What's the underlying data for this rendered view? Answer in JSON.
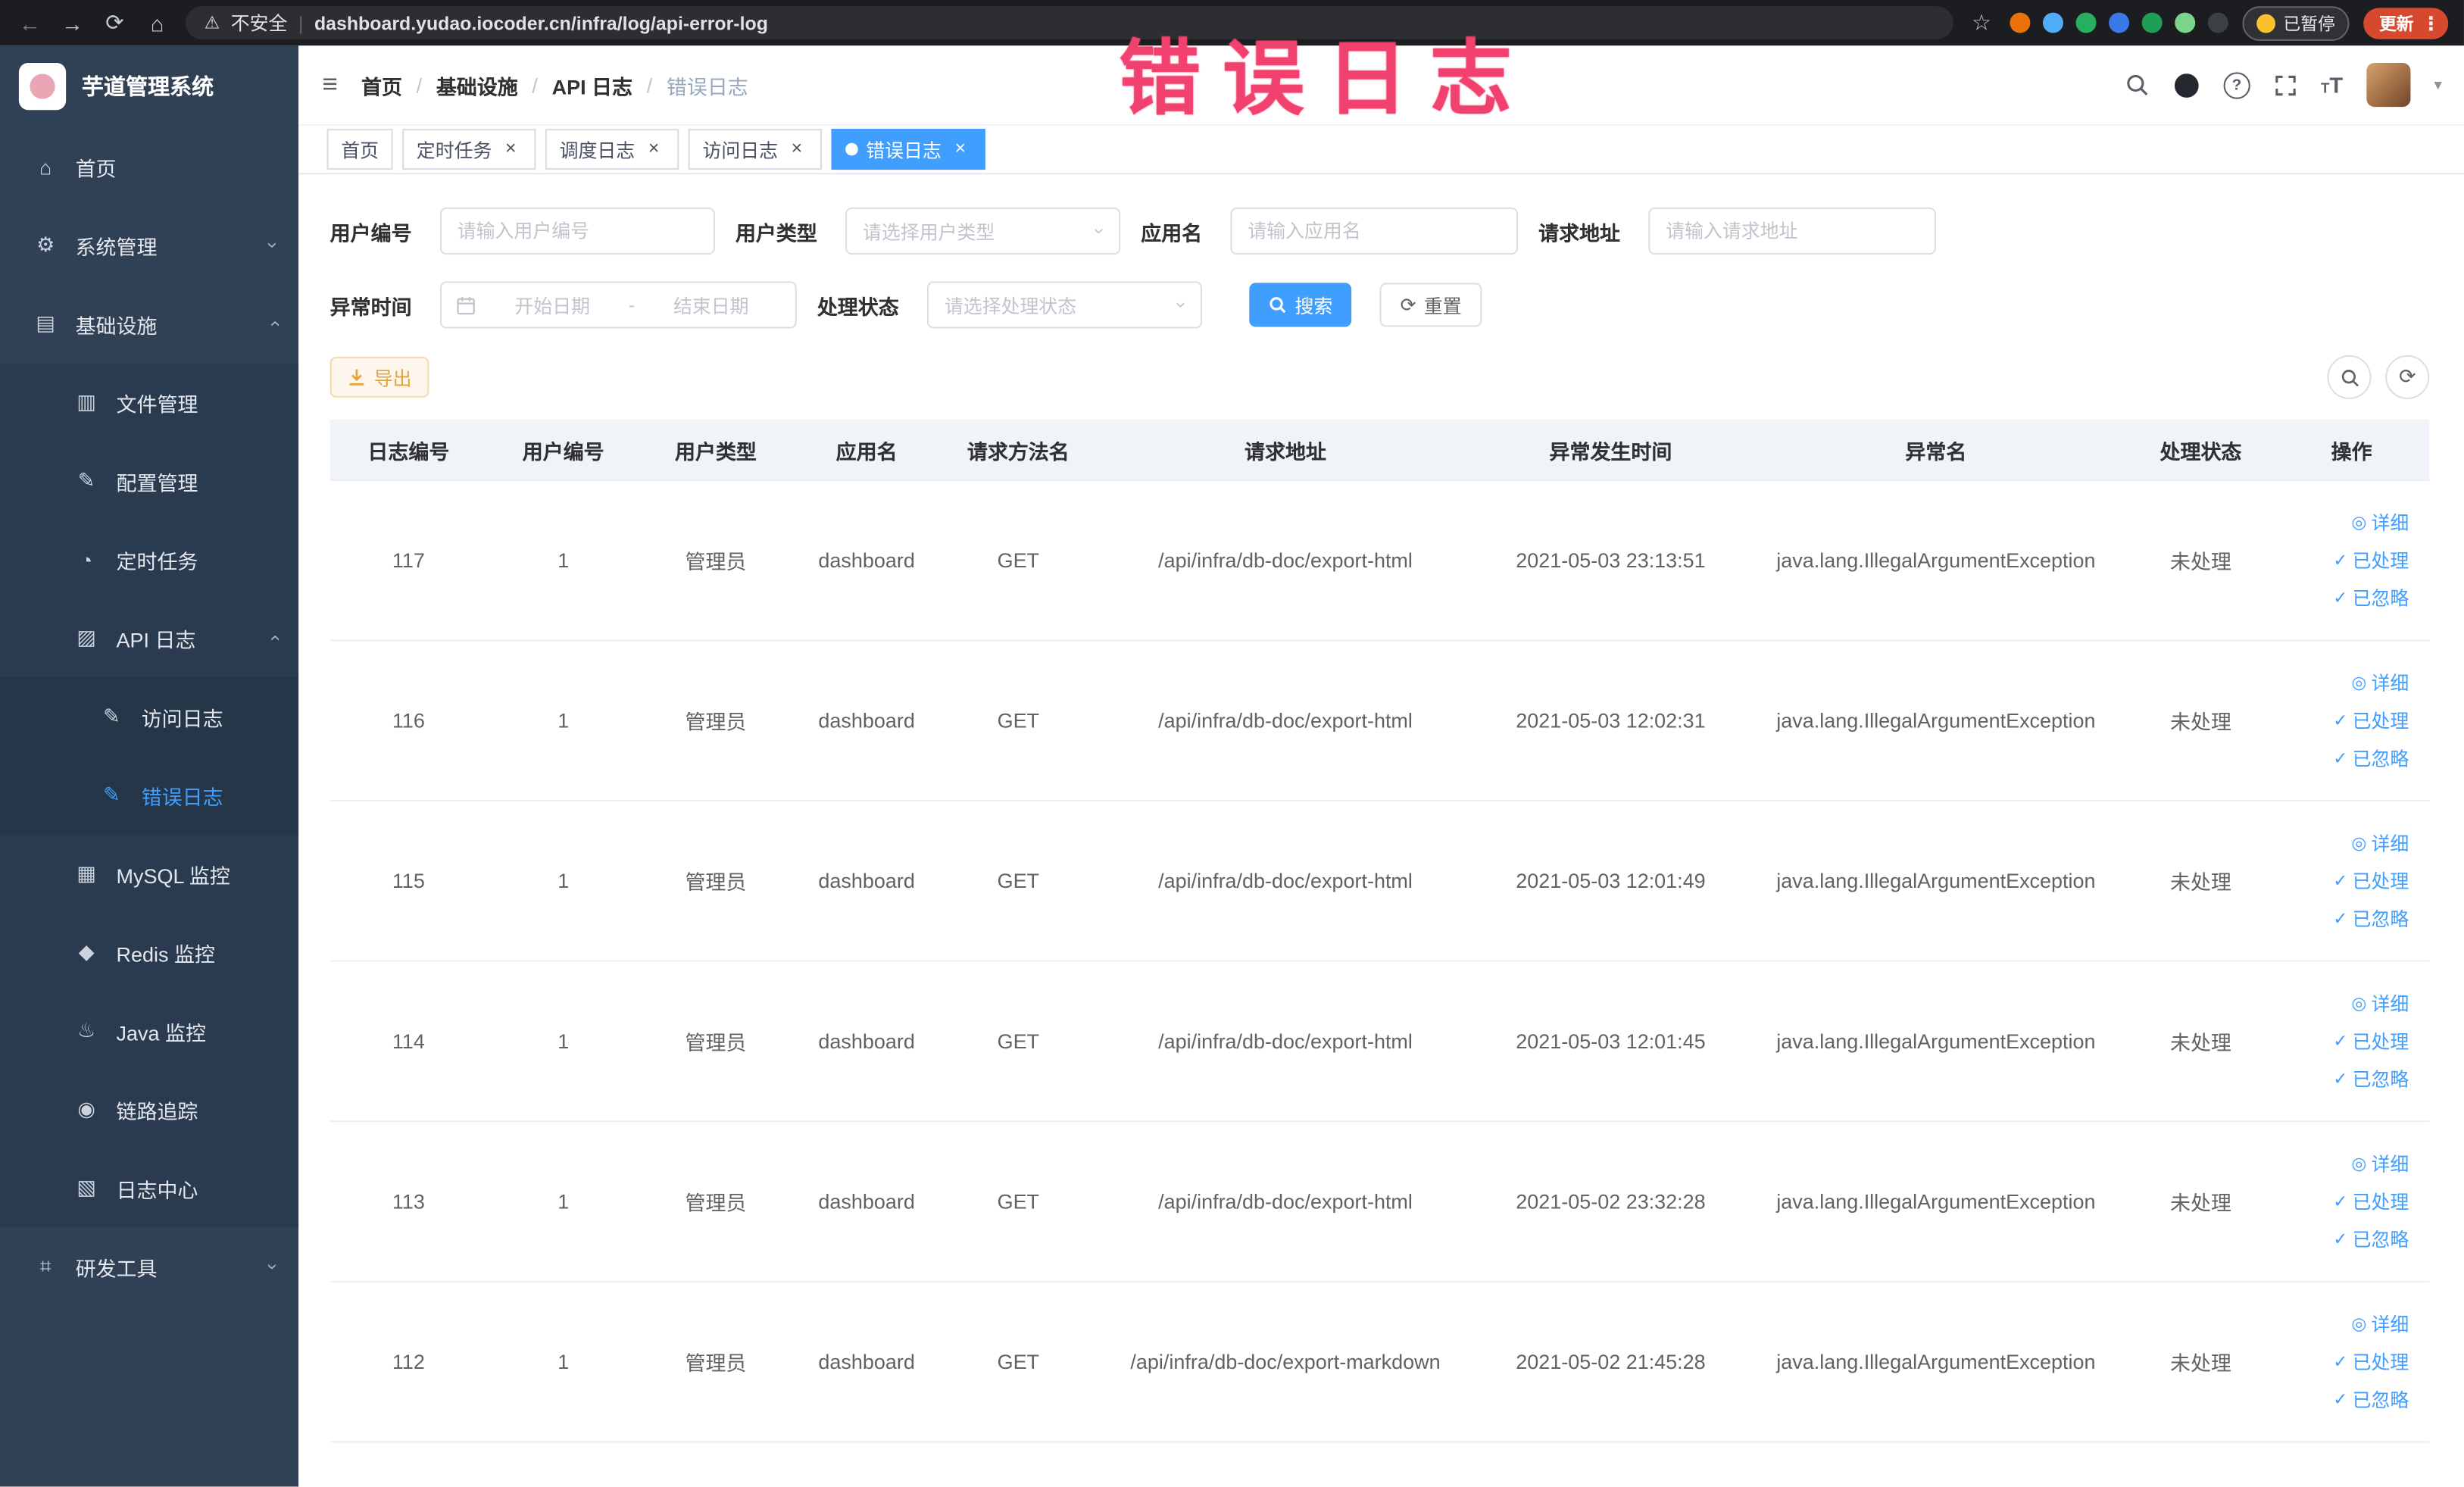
{
  "watermark": "错误日志",
  "icons": {
    "home": "⌂",
    "system": "⚙",
    "infra": "▤",
    "file": "▥",
    "config": "✎",
    "timer": "◔",
    "apilog": "▨",
    "accesslog": "✎",
    "errorlog": "✎",
    "mysql": "▦",
    "redis": "◆",
    "java": "♨",
    "trace": "◉",
    "logcenter": "▧",
    "devtools": "⌗"
  },
  "browser": {
    "security_label": "不安全",
    "url": "dashboard.yudao.iocoder.cn/infra/log/api-error-log",
    "paused_label": "已暂停",
    "update_label": "更新",
    "extension_colors": [
      "#e8710a",
      "#4facf7",
      "#27ae60",
      "#3b78e7",
      "#1e9e57",
      "#7bd48a",
      "#3c4043"
    ]
  },
  "sidebar": {
    "app_title": "芋道管理系统",
    "items": [
      {
        "key": "home",
        "label": "首页",
        "icon": "home",
        "level": 1
      },
      {
        "key": "system",
        "label": "系统管理",
        "icon": "system",
        "level": 1,
        "arrow": "down"
      },
      {
        "key": "infra",
        "label": "基础设施",
        "icon": "infra",
        "level": 1,
        "arrow": "up"
      },
      {
        "key": "file-mgmt",
        "label": "文件管理",
        "icon": "file",
        "level": 2
      },
      {
        "key": "config-mgmt",
        "label": "配置管理",
        "icon": "config",
        "level": 2
      },
      {
        "key": "cron-job",
        "label": "定时任务",
        "icon": "timer",
        "level": 2
      },
      {
        "key": "api-log",
        "label": "API 日志",
        "icon": "apilog",
        "level": 2,
        "arrow": "up"
      },
      {
        "key": "access-log",
        "label": "访问日志",
        "icon": "accesslog",
        "level": 3
      },
      {
        "key": "error-log",
        "label": "错误日志",
        "icon": "errorlog",
        "level": 3,
        "active": true
      },
      {
        "key": "mysql-monitor",
        "label": "MySQL 监控",
        "icon": "mysql",
        "level": 2
      },
      {
        "key": "redis-monitor",
        "label": "Redis 监控",
        "icon": "redis",
        "level": 2
      },
      {
        "key": "java-monitor",
        "label": "Java 监控",
        "icon": "java",
        "level": 2
      },
      {
        "key": "trace",
        "label": "链路追踪",
        "icon": "trace",
        "level": 2
      },
      {
        "key": "log-center",
        "label": "日志中心",
        "icon": "logcenter",
        "level": 2
      },
      {
        "key": "dev-tools",
        "label": "研发工具",
        "icon": "devtools",
        "level": 1,
        "arrow": "down"
      }
    ]
  },
  "header": {
    "breadcrumb": [
      "首页",
      "基础设施",
      "API 日志",
      "错误日志"
    ]
  },
  "tabs": [
    {
      "key": "home",
      "label": "首页",
      "closable": false,
      "active": false
    },
    {
      "key": "cron-job",
      "label": "定时任务",
      "closable": true,
      "active": false
    },
    {
      "key": "job-log",
      "label": "调度日志",
      "closable": true,
      "active": false
    },
    {
      "key": "access-log",
      "label": "访问日志",
      "closable": true,
      "active": false
    },
    {
      "key": "error-log",
      "label": "错误日志",
      "closable": true,
      "active": true
    }
  ],
  "filters": {
    "user_id_label": "用户编号",
    "user_id_placeholder": "请输入用户编号",
    "user_type_label": "用户类型",
    "user_type_placeholder": "请选择用户类型",
    "app_name_label": "应用名",
    "app_name_placeholder": "请输入应用名",
    "request_url_label": "请求地址",
    "request_url_placeholder": "请输入请求地址",
    "exception_time_label": "异常时间",
    "start_date_placeholder": "开始日期",
    "end_date_placeholder": "结束日期",
    "range_separator": "-",
    "process_status_label": "处理状态",
    "process_status_placeholder": "请选择处理状态",
    "search_label": "搜索",
    "reset_label": "重置"
  },
  "toolbar": {
    "export_label": "导出"
  },
  "table": {
    "columns": [
      "日志编号",
      "用户编号",
      "用户类型",
      "应用名",
      "请求方法名",
      "请求地址",
      "异常发生时间",
      "异常名",
      "处理状态",
      "操作"
    ],
    "actions": {
      "detail": "详细",
      "processed": "已处理",
      "ignored": "已忽略"
    },
    "rows": [
      {
        "id": "117",
        "user_id": "1",
        "user_type": "管理员",
        "app": "dashboard",
        "method": "GET",
        "url": "/api/infra/db-doc/export-html",
        "time": "2021-05-03 23:13:51",
        "exception": "java.lang.IllegalArgumentException",
        "status": "未处理"
      },
      {
        "id": "116",
        "user_id": "1",
        "user_type": "管理员",
        "app": "dashboard",
        "method": "GET",
        "url": "/api/infra/db-doc/export-html",
        "time": "2021-05-03 12:02:31",
        "exception": "java.lang.IllegalArgumentException",
        "status": "未处理"
      },
      {
        "id": "115",
        "user_id": "1",
        "user_type": "管理员",
        "app": "dashboard",
        "method": "GET",
        "url": "/api/infra/db-doc/export-html",
        "time": "2021-05-03 12:01:49",
        "exception": "java.lang.IllegalArgumentException",
        "status": "未处理"
      },
      {
        "id": "114",
        "user_id": "1",
        "user_type": "管理员",
        "app": "dashboard",
        "method": "GET",
        "url": "/api/infra/db-doc/export-html",
        "time": "2021-05-03 12:01:45",
        "exception": "java.lang.IllegalArgumentException",
        "status": "未处理"
      },
      {
        "id": "113",
        "user_id": "1",
        "user_type": "管理员",
        "app": "dashboard",
        "method": "GET",
        "url": "/api/infra/db-doc/export-html",
        "time": "2021-05-02 23:32:28",
        "exception": "java.lang.IllegalArgumentException",
        "status": "未处理"
      },
      {
        "id": "112",
        "user_id": "1",
        "user_type": "管理员",
        "app": "dashboard",
        "method": "GET",
        "url": "/api/infra/db-doc/export-markdown",
        "time": "2021-05-02 21:45:28",
        "exception": "java.lang.IllegalArgumentException",
        "status": "未处理"
      }
    ]
  }
}
